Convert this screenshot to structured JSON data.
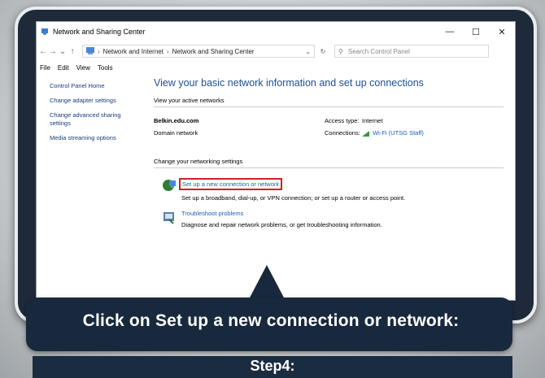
{
  "window": {
    "title": "Network and Sharing Center",
    "controls": {
      "minimize": "—",
      "maximize": "☐",
      "close": "✕"
    }
  },
  "addressbar": {
    "breadcrumbs": [
      "Network and Internet",
      "Network and Sharing Center"
    ],
    "search_placeholder": "Search Control Panel"
  },
  "menu": [
    "File",
    "Edit",
    "View",
    "Tools"
  ],
  "sidebar": {
    "items": [
      "Control Panel Home",
      "Change adapter settings",
      "Change advanced sharing settings",
      "Media streaming options"
    ]
  },
  "main": {
    "heading": "View your basic network information and set up connections",
    "active_networks_label": "View your active networks",
    "network_name": "Belkin.edu.com",
    "network_type": "Domain network",
    "access_type_label": "Access type:",
    "access_type_value": "Internet",
    "connections_label": "Connections:",
    "connections_value": "Wi-Fi (UTSG Staff)",
    "change_settings_label": "Change your networking settings",
    "tasks": [
      {
        "title": "Set up a new connection or network",
        "description": "Set up a broadband, dial-up, or VPN connection; or set up a router or access point.",
        "icon": "network-setup-icon"
      },
      {
        "title": "Troubleshoot problems",
        "description": "Diagnose and repair network problems, or get troubleshooting information.",
        "icon": "troubleshoot-icon"
      }
    ]
  },
  "callout": {
    "text": "Click on Set up a new connection or network:",
    "step": "Step4:"
  },
  "colors": {
    "accent_link": "#1d5fb4",
    "highlight": "#d21f1f",
    "frame": "#1e2a3a"
  }
}
